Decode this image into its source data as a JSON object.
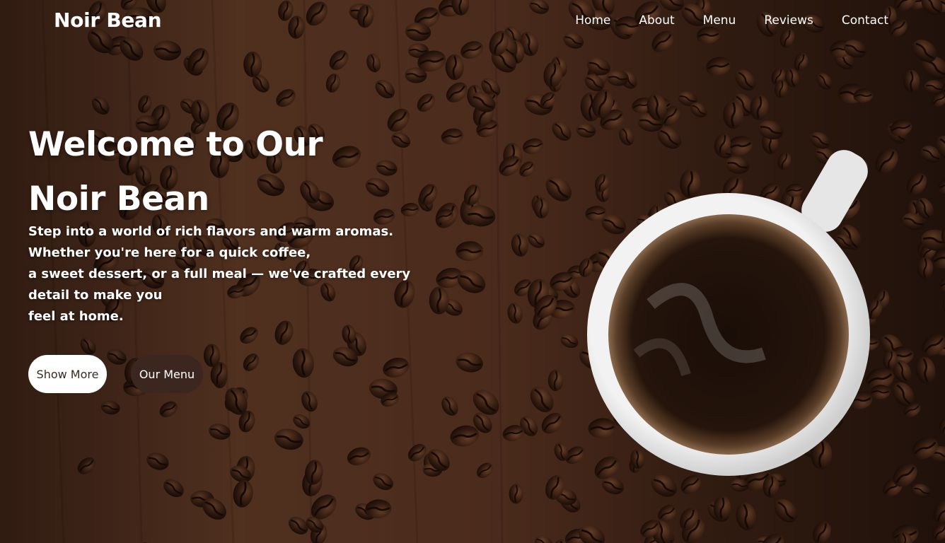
{
  "nav": {
    "brand": "Noir Bean",
    "links": [
      "Home",
      "About",
      "Menu",
      "Reviews",
      "Contact"
    ]
  },
  "hero": {
    "title_lines": [
      "Welcome to Our",
      "Noir Bean"
    ],
    "text_lines": [
      "Step into a world of rich flavors and warm aromas.",
      "Whether you're here for a quick coffee,",
      "a sweet dessert, or a full meal — we've crafted every",
      "detail to make you",
      "feel at home."
    ],
    "buttons": {
      "show_more": "Show More",
      "our_menu": "Our Menu"
    }
  },
  "colors": {
    "wood": "#5b3624",
    "bean": "#3a2216",
    "button_dark": "#3b2620",
    "cup": "#ececec"
  }
}
